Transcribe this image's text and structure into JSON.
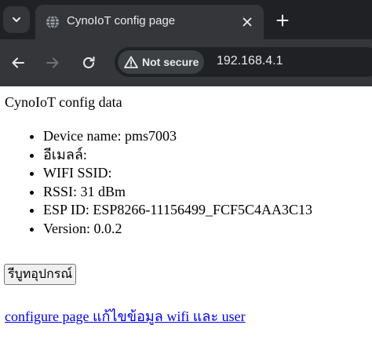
{
  "browser": {
    "tab": {
      "title": "CynoIoT config page"
    },
    "toolbar": {
      "security_label": "Not secure",
      "url": "192.168.4.1"
    },
    "colors": {
      "frame": "#202124",
      "toolbar": "#35363a",
      "text": "#e8eaed"
    },
    "icons": [
      "tab-list-chevron-icon",
      "globe-icon",
      "close-icon",
      "plus-icon",
      "back-arrow-icon",
      "forward-arrow-icon",
      "reload-icon",
      "warning-triangle-icon"
    ]
  },
  "page": {
    "heading": "CynoIoT config data",
    "info_items": [
      "Device name: pms7003",
      "อีเมลล์:",
      "WIFI SSID:",
      "RSSI: 31 dBm",
      "ESP ID: ESP8266-11156499_FCF5C4AA3C13",
      "Version: 0.0.2"
    ],
    "reset_button": "รีบูทอุปกรณ์",
    "config_link": "configure page แก้ไขข้อมูล wifi และ user",
    "colors": {
      "link": "#0000ee"
    }
  }
}
